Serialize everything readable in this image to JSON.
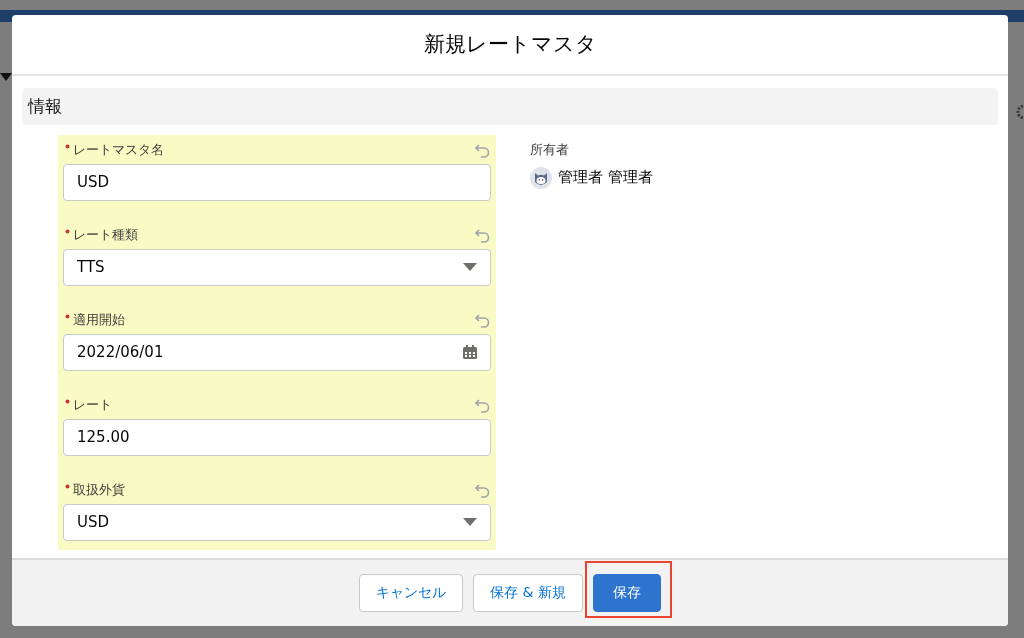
{
  "modal": {
    "title": "新規レートマスタ"
  },
  "section": {
    "title": "情報"
  },
  "fields": [
    {
      "kind": "text",
      "label": "レートマスタ名",
      "value": "USD",
      "required": true,
      "edited": true
    },
    {
      "kind": "select",
      "label": "レート種類",
      "value": "TTS",
      "required": true,
      "edited": true
    },
    {
      "kind": "date",
      "label": "適用開始",
      "value": "2022/06/01",
      "required": true,
      "edited": true
    },
    {
      "kind": "text",
      "label": "レート",
      "value": "125.00",
      "required": true,
      "edited": true
    },
    {
      "kind": "select",
      "label": "取扱外貨",
      "value": "USD",
      "required": true,
      "edited": true
    }
  ],
  "owner": {
    "label": "所有者",
    "name": "管理者 管理者"
  },
  "buttons": [
    {
      "label": "キャンセル",
      "kind": "neutral",
      "annotated": false
    },
    {
      "label": "保存 & 新規",
      "kind": "neutral",
      "annotated": false
    },
    {
      "label": "保存",
      "kind": "brand",
      "annotated": true
    }
  ]
}
